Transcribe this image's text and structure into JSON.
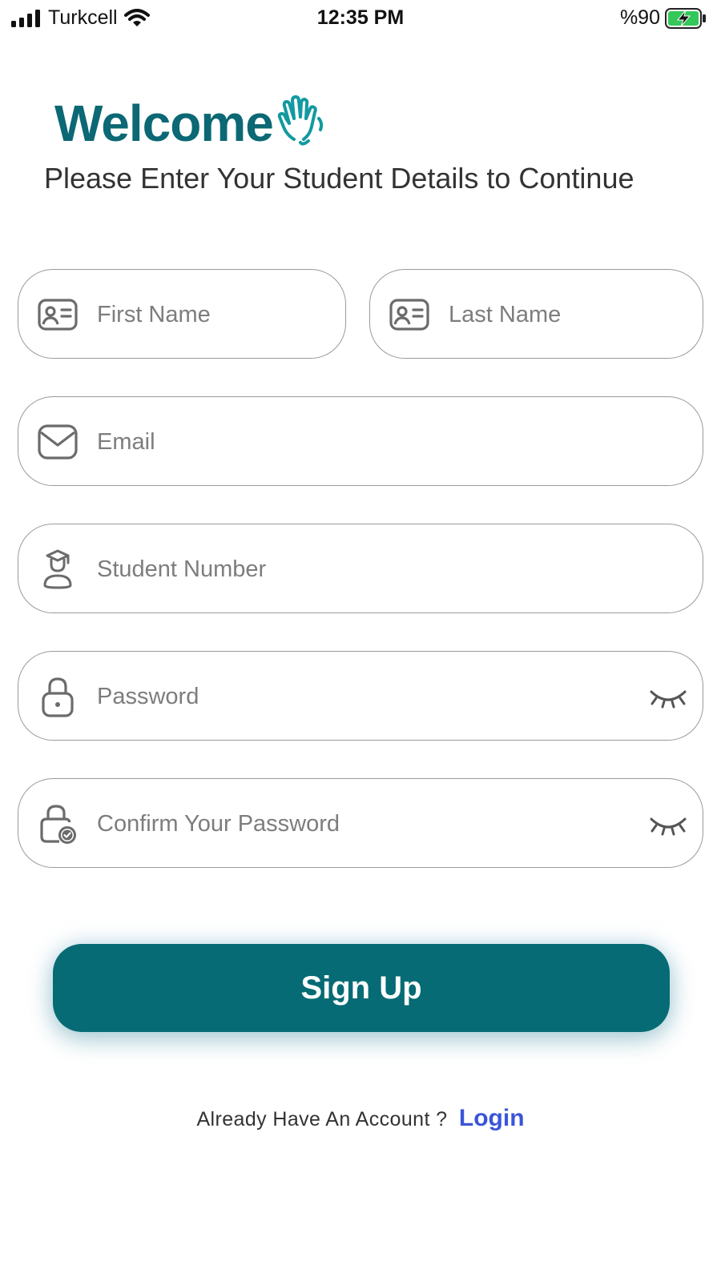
{
  "status_bar": {
    "carrier": "Turkcell",
    "time": "12:35 PM",
    "battery": "%90"
  },
  "header": {
    "title": "Welcome",
    "subtitle": "Please Enter Your Student Details to Continue"
  },
  "form": {
    "first_name": {
      "placeholder": "First Name",
      "value": ""
    },
    "last_name": {
      "placeholder": "Last Name",
      "value": ""
    },
    "email": {
      "placeholder": "Email",
      "value": ""
    },
    "student_number": {
      "placeholder": "Student Number",
      "value": ""
    },
    "password": {
      "placeholder": "Password",
      "value": ""
    },
    "confirm_password": {
      "placeholder": "Confirm Your Password",
      "value": ""
    }
  },
  "actions": {
    "signup_label": "Sign Up",
    "already_text": "Already Have An Account ?",
    "login_label": "Login"
  },
  "icons": {
    "signal": "signal-icon",
    "wifi": "wifi-icon",
    "battery": "battery-charging-icon",
    "wave": "waving-hand-icon",
    "id_card": "id-card-icon",
    "mail": "mail-icon",
    "student": "graduate-icon",
    "lock": "lock-icon",
    "lock_check": "lock-check-icon",
    "eye_closed": "eye-closed-icon"
  },
  "colors": {
    "brand": "#066b74",
    "link": "#3a55d8",
    "battery_fill": "#34c759"
  }
}
